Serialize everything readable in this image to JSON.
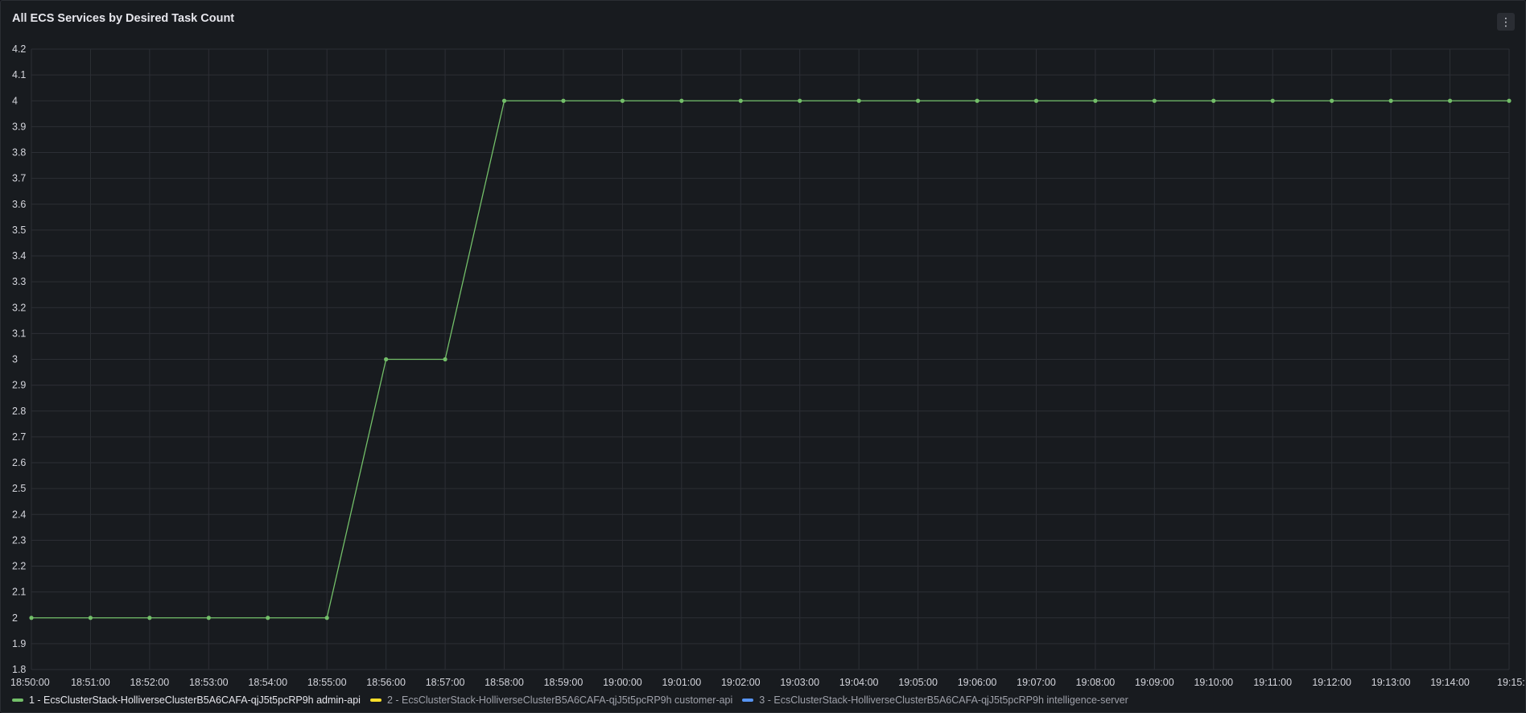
{
  "panel": {
    "title": "All ECS Services by Desired Task Count",
    "menu_icon": "kebab-menu-icon",
    "menu_glyph": "⋮"
  },
  "chart_data": {
    "type": "line",
    "title": "All ECS Services by Desired Task Count",
    "xlabel": "",
    "ylabel": "",
    "ylim": [
      1.8,
      4.2
    ],
    "y_ticks": [
      "1.8",
      "1.9",
      "2",
      "2.1",
      "2.2",
      "2.3",
      "2.4",
      "2.5",
      "2.6",
      "2.7",
      "2.8",
      "2.9",
      "3",
      "3.1",
      "3.2",
      "3.3",
      "3.4",
      "3.5",
      "3.6",
      "3.7",
      "3.8",
      "3.9",
      "4",
      "4.1",
      "4.2"
    ],
    "x": [
      "18:50:00",
      "18:51:00",
      "18:52:00",
      "18:53:00",
      "18:54:00",
      "18:55:00",
      "18:56:00",
      "18:57:00",
      "18:58:00",
      "18:59:00",
      "19:00:00",
      "19:01:00",
      "19:02:00",
      "19:03:00",
      "19:04:00",
      "19:05:00",
      "19:06:00",
      "19:07:00",
      "19:08:00",
      "19:09:00",
      "19:10:00",
      "19:11:00",
      "19:12:00",
      "19:13:00",
      "19:14:00",
      "19:15:"
    ],
    "grid": true,
    "legend_position": "bottom",
    "series": [
      {
        "name": "1 - EcsClusterStack-HolliverseClusterB5A6CAFA-qjJ5t5pcRP9h admin-api",
        "color": "#73bf69",
        "values": [
          2,
          2,
          2,
          2,
          2,
          2,
          3,
          3,
          4,
          4,
          4,
          4,
          4,
          4,
          4,
          4,
          4,
          4,
          4,
          4,
          4,
          4,
          4,
          4,
          4,
          4
        ]
      },
      {
        "name": "2 - EcsClusterStack-HolliverseClusterB5A6CAFA-qjJ5t5pcRP9h customer-api",
        "color": "#fade2a",
        "values": []
      },
      {
        "name": "3 - EcsClusterStack-HolliverseClusterB5A6CAFA-qjJ5t5pcRP9h intelligence-server",
        "color": "#5794f2",
        "values": []
      }
    ]
  }
}
